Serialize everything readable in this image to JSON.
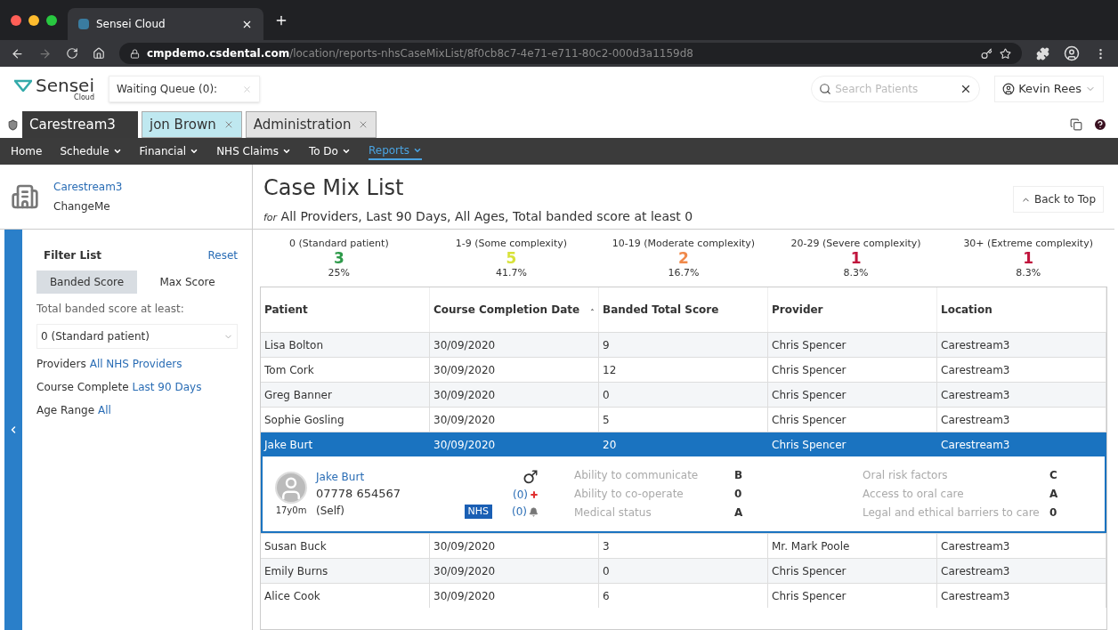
{
  "browser": {
    "tab_title": "Sensei Cloud",
    "url_host": "cmpdemo.csdental.com",
    "url_path": "/location/reports-nhsCaseMixList/8f0cb8c7-4e71-e711-80c2-000d3a1159d8"
  },
  "header": {
    "logo": "Sensei",
    "logo_sub": "Cloud",
    "waiting_queue": "Waiting Queue (0):",
    "search_placeholder": "Search Patients",
    "user": "Kevin Rees"
  },
  "app_tabs": [
    {
      "label": "Carestream3",
      "kind": "home",
      "selected": true,
      "closable": false
    },
    {
      "label": "jon Brown",
      "kind": "patient",
      "selected": false,
      "closable": true
    },
    {
      "label": "Administration",
      "kind": "admin",
      "selected": false,
      "closable": true
    }
  ],
  "menu": [
    {
      "label": "Home",
      "dropdown": false,
      "selected": false
    },
    {
      "label": "Schedule",
      "dropdown": true,
      "selected": false
    },
    {
      "label": "Financial",
      "dropdown": true,
      "selected": false
    },
    {
      "label": "NHS Claims",
      "dropdown": true,
      "selected": false
    },
    {
      "label": "To Do",
      "dropdown": true,
      "selected": false
    },
    {
      "label": "Reports",
      "dropdown": true,
      "selected": true
    }
  ],
  "location": {
    "name": "Carestream3",
    "sub": "ChangeMe"
  },
  "filter": {
    "title": "Filter List",
    "reset": "Reset",
    "toggles": [
      {
        "label": "Banded Score",
        "selected": true
      },
      {
        "label": "Max Score",
        "selected": false
      }
    ],
    "score_label": "Total banded score at least:",
    "score_value": "0 (Standard patient)",
    "rows": [
      {
        "label": "Providers",
        "value": "All NHS Providers"
      },
      {
        "label": "Course Complete",
        "value": "Last 90 Days"
      },
      {
        "label": "Age Range",
        "value": "All"
      }
    ]
  },
  "page": {
    "title": "Case Mix List",
    "subtitle_prefix": "for",
    "subtitle": "All Providers, Last 90 Days, All Ages, Total banded score at least 0",
    "back_to_top": "Back to Top"
  },
  "summary": [
    {
      "label": "0 (Standard patient)",
      "count": "3",
      "percent": "25%",
      "color": "#2e9a4a"
    },
    {
      "label": "1-9 (Some complexity)",
      "count": "5",
      "percent": "41.7%",
      "color": "#d8e23a"
    },
    {
      "label": "10-19 (Moderate complexity)",
      "count": "2",
      "percent": "16.7%",
      "color": "#f0894a"
    },
    {
      "label": "20-29 (Severe complexity)",
      "count": "1",
      "percent": "8.3%",
      "color": "#c0143c"
    },
    {
      "label": "30+ (Extreme complexity)",
      "count": "1",
      "percent": "8.3%",
      "color": "#c0143c"
    }
  ],
  "table": {
    "columns": [
      {
        "label": "Patient",
        "sorted": false
      },
      {
        "label": "Course Completion Date",
        "sorted": true
      },
      {
        "label": "Banded Total Score",
        "sorted": false
      },
      {
        "label": "Provider",
        "sorted": false
      },
      {
        "label": "Location",
        "sorted": false
      }
    ],
    "rows": [
      {
        "cells": [
          "Lisa Bolton",
          "30/09/2020",
          "9",
          "Chris Spencer",
          "Carestream3"
        ],
        "selected": false
      },
      {
        "cells": [
          "Tom Cork",
          "30/09/2020",
          "12",
          "Chris Spencer",
          "Carestream3"
        ],
        "selected": false
      },
      {
        "cells": [
          "Greg Banner",
          "30/09/2020",
          "0",
          "Chris Spencer",
          "Carestream3"
        ],
        "selected": false
      },
      {
        "cells": [
          "Sophie Gosling",
          "30/09/2020",
          "5",
          "Chris Spencer",
          "Carestream3"
        ],
        "selected": false
      },
      {
        "cells": [
          "Jake Burt",
          "30/09/2020",
          "20",
          "Chris Spencer",
          "Carestream3"
        ],
        "selected": true,
        "detail": {
          "name": "Jake Burt",
          "phone": "07778 654567",
          "age": "17y0m",
          "relation": "(Self)",
          "gender": "♂",
          "alerts": "(0)",
          "notes": "(0)",
          "badge": "NHS",
          "scores": [
            {
              "label": "Ability to communicate",
              "value": "B"
            },
            {
              "label": "Ability to co-operate",
              "value": "0"
            },
            {
              "label": "Medical status",
              "value": "A"
            }
          ],
          "scores_2": [
            {
              "label": "Oral risk factors",
              "value": "C"
            },
            {
              "label": "Access to oral care",
              "value": "A"
            },
            {
              "label": "Legal and ethical barriers to care",
              "value": "0"
            }
          ]
        }
      },
      {
        "cells": [
          "Susan Buck",
          "30/09/2020",
          "3",
          "Mr. Mark Poole",
          "Carestream3"
        ],
        "selected": false
      },
      {
        "cells": [
          "Emily Burns",
          "30/09/2020",
          "0",
          "Chris Spencer",
          "Carestream3"
        ],
        "selected": false
      },
      {
        "cells": [
          "Alice Cook",
          "30/09/2020",
          "6",
          "Chris Spencer",
          "Carestream3"
        ],
        "selected": false
      }
    ]
  }
}
